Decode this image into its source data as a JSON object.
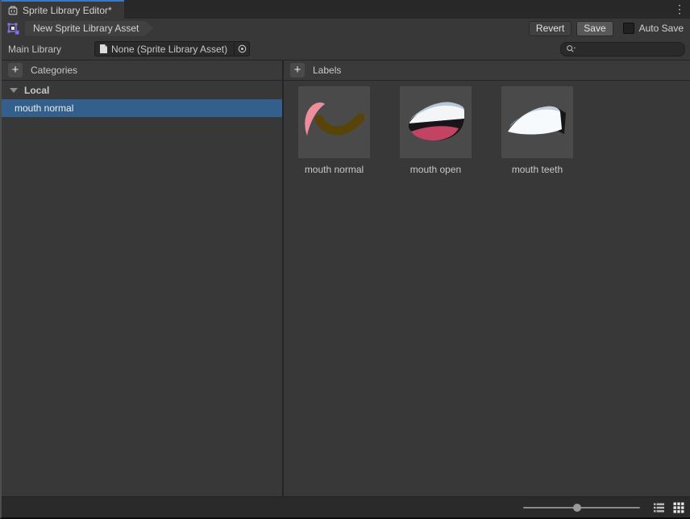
{
  "window": {
    "tab_title": "Sprite Library Editor*",
    "tab_icon": "sprite-library-editor-icon",
    "menu_icon": "kebab-menu-icon"
  },
  "toolbar": {
    "asset_icon": "sprite-library-asset-icon",
    "breadcrumb": "New Sprite Library Asset",
    "revert_label": "Revert",
    "save_label": "Save",
    "auto_save_label": "Auto Save",
    "auto_save_checked": false
  },
  "main_library": {
    "label": "Main Library",
    "object_field_value": "None (Sprite Library Asset)",
    "object_field_icon": "asset-file-icon",
    "picker_icon": "target-picker-icon",
    "search_value": "",
    "search_icon": "search-icon"
  },
  "categories": {
    "header": "Categories",
    "add_icon": "plus-icon",
    "add_label": "+",
    "groups": [
      {
        "label": "Local",
        "expanded": true,
        "items": [
          {
            "label": "mouth normal",
            "selected": true
          }
        ]
      }
    ]
  },
  "labels_panel": {
    "header": "Labels",
    "add_icon": "plus-icon",
    "add_label": "+",
    "items": [
      {
        "label": "mouth normal",
        "thumbnail": "sprite-mouth-normal"
      },
      {
        "label": "mouth open",
        "thumbnail": "sprite-mouth-open"
      },
      {
        "label": "mouth teeth",
        "thumbnail": "sprite-mouth-teeth"
      }
    ]
  },
  "bottom_bar": {
    "slider_position": 0.43,
    "list_view_icon": "list-view-icon",
    "grid_view_icon": "grid-view-icon",
    "active_view": "grid"
  },
  "colors": {
    "accent_blue": "#3a79bb",
    "selection_blue": "#325f8c",
    "asset_icon_purple": "#8673e0",
    "panel_bg": "#383838",
    "dark_bg": "#282828",
    "field_bg": "#2a2a2a"
  }
}
